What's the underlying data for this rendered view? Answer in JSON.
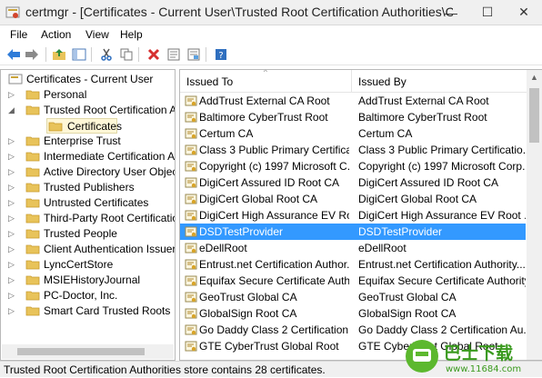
{
  "window": {
    "title": "certmgr - [Certificates - Current User\\Trusted Root Certification Authorities\\Cer...",
    "minimize": "—",
    "maximize": "☐",
    "close": "✕"
  },
  "menu": {
    "file": "File",
    "action": "Action",
    "view": "View",
    "help": "Help"
  },
  "tree": {
    "root": "Certificates - Current User",
    "items": [
      "Personal",
      "Trusted Root Certification Au",
      "Certificates",
      "Enterprise Trust",
      "Intermediate Certification Au",
      "Active Directory User Object",
      "Trusted Publishers",
      "Untrusted Certificates",
      "Third-Party Root Certification",
      "Trusted People",
      "Client Authentication Issuers",
      "LyncCertStore",
      "MSIEHistoryJournal",
      "PC-Doctor, Inc.",
      "Smart Card Trusted Roots"
    ]
  },
  "list": {
    "columns": [
      "Issued To",
      "Issued By"
    ],
    "rows": [
      [
        "AddTrust External CA Root",
        "AddTrust External CA Root"
      ],
      [
        "Baltimore CyberTrust Root",
        "Baltimore CyberTrust Root"
      ],
      [
        "Certum CA",
        "Certum CA"
      ],
      [
        "Class 3 Public Primary Certificat...",
        "Class 3 Public Primary Certificatio..."
      ],
      [
        "Copyright (c) 1997 Microsoft C...",
        "Copyright (c) 1997 Microsoft Corp."
      ],
      [
        "DigiCert Assured ID Root CA",
        "DigiCert Assured ID Root CA"
      ],
      [
        "DigiCert Global Root CA",
        "DigiCert Global Root CA"
      ],
      [
        "DigiCert High Assurance EV Ro...",
        "DigiCert High Assurance EV Root ..."
      ],
      [
        "DSDTestProvider",
        "DSDTestProvider"
      ],
      [
        "eDellRoot",
        "eDellRoot"
      ],
      [
        "Entrust.net Certification Author...",
        "Entrust.net Certification Authority..."
      ],
      [
        "Equifax Secure Certificate Auth...",
        "Equifax Secure Certificate Authority"
      ],
      [
        "GeoTrust Global CA",
        "GeoTrust Global CA"
      ],
      [
        "GlobalSign Root CA",
        "GlobalSign Root CA"
      ],
      [
        "Go Daddy Class 2 Certification ...",
        "Go Daddy Class 2 Certification Au..."
      ],
      [
        "GTE CyberTrust Global Root",
        "GTE CyberTrust Global Root"
      ]
    ],
    "selected_index": 8
  },
  "status": "Trusted Root Certification Authorities store contains 28 certificates.",
  "watermark": {
    "main": "巴士下载",
    "sub": "www.11684.com"
  },
  "colors": {
    "selection": "#3399ff",
    "folder": "#e8c35a",
    "accent_blue": "#1e6fd0",
    "watermark_green": "#5cb82e"
  }
}
